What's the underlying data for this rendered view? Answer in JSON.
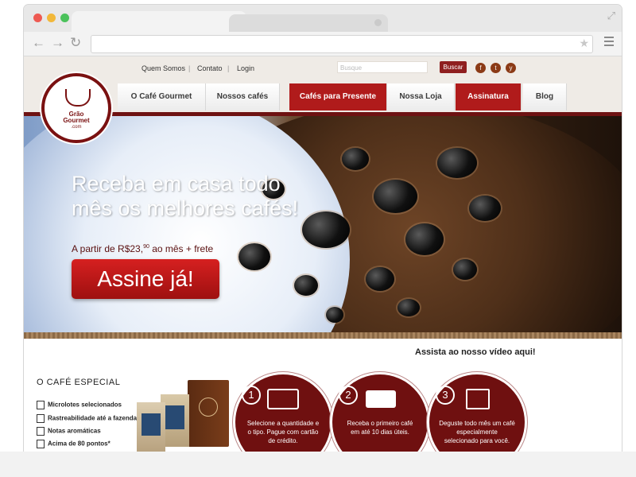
{
  "header": {
    "links": [
      "Quem Somos",
      "Contato",
      "Login"
    ],
    "search_placeholder": "Busque",
    "search_button": "Buscar",
    "social": [
      "f",
      "t",
      "y"
    ]
  },
  "logo": {
    "line1": "Grão",
    "line2": "Gourmet",
    "line3": ".com"
  },
  "nav": {
    "items": [
      "O Café Gourmet",
      "Nossos cafés",
      "Cafés para Presente",
      "Nossa Loja",
      "Assinatura",
      "Blog"
    ]
  },
  "hero": {
    "title_line1": "Receba em casa todo",
    "title_line2": "mês os melhores cafés!",
    "price_prefix": "A partir de R$23,",
    "price_cents": "90",
    "price_suffix": " ao mês + frete",
    "cta": "Assine já!"
  },
  "video_label": "Assista ao nosso vídeo aqui!",
  "special": {
    "title": "O CAFÉ ESPECIAL",
    "features": [
      "Microlotes selecionados",
      "Rastreabilidade até a fazenda",
      "Notas aromáticas",
      "Acima de 80 pontos*"
    ]
  },
  "steps": [
    {
      "num": "1",
      "text": "Selecione a quantidade e o tipo. Pague com cartão de crédito."
    },
    {
      "num": "2",
      "text": "Receba o primeiro café em até 10 dias úteis."
    },
    {
      "num": "3",
      "text": "Deguste todo mês um café especialmente selecionado para você."
    }
  ],
  "colors": {
    "brand": "#b01b1b",
    "dark": "#6f1010"
  }
}
